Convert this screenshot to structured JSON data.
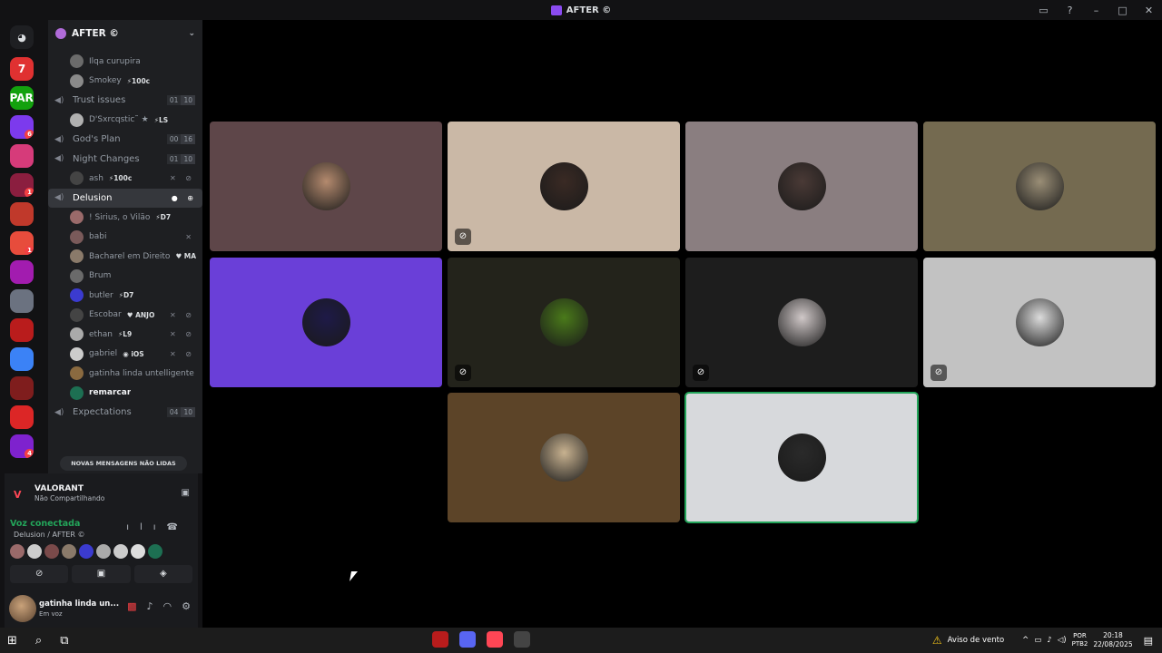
{
  "window": {
    "title": "AFTER ©"
  },
  "server": {
    "name": "AFTER ©"
  },
  "rail": [
    {
      "label": "7",
      "color": "#e03131"
    },
    {
      "label": "SPARK",
      "color": "#13a10e"
    },
    {
      "label": "",
      "color": "#7c3aed",
      "badge": "6"
    },
    {
      "label": "",
      "color": "#d63b7a"
    },
    {
      "label": "",
      "color": "#8b1e3f",
      "badge": "1"
    },
    {
      "label": "",
      "color": "#c0392b"
    },
    {
      "label": "",
      "color": "#e74c3c",
      "badge": "1"
    },
    {
      "label": "",
      "color": "#a21caf"
    },
    {
      "label": "",
      "color": "#6b7280"
    },
    {
      "label": "",
      "color": "#b91c1c"
    },
    {
      "label": "",
      "color": "#3b82f6"
    },
    {
      "label": "",
      "color": "#7f1d1d"
    },
    {
      "label": "",
      "color": "#dc2626"
    },
    {
      "label": "",
      "color": "#7e22ce",
      "badge": "4"
    }
  ],
  "channel_rows": [
    {
      "kind": "user",
      "name": "Ilqa curupira",
      "tag": "",
      "status": "",
      "avatar": "#6b6b6b"
    },
    {
      "kind": "user",
      "name": "Smokey",
      "tag": "⚡100c",
      "status": "",
      "avatar": "#8a8a8a"
    },
    {
      "kind": "channel",
      "name": "Trust issues",
      "count_a": "01",
      "count_b": "10"
    },
    {
      "kind": "user",
      "name": "D'Sxrcqstic˜ ★",
      "tag": "⚡LS",
      "status": "",
      "avatar": "#b0b0b0"
    },
    {
      "kind": "channel",
      "name": "God's Plan",
      "count_a": "00",
      "count_b": "16"
    },
    {
      "kind": "channel",
      "name": "Night Changes",
      "count_a": "01",
      "count_b": "10"
    },
    {
      "kind": "user",
      "name": "ash",
      "tag": "⚡100c",
      "status": "✕ ⊘",
      "avatar": "#444"
    },
    {
      "kind": "active",
      "name": "Delusion"
    },
    {
      "kind": "user",
      "name": "! Sirius, o Vilão",
      "tag": "⚡D7",
      "status": "",
      "avatar": "#9a6a6a"
    },
    {
      "kind": "user",
      "name": "babi",
      "tag": "",
      "status": "✕",
      "avatar": "#7a5a5a"
    },
    {
      "kind": "user",
      "name": "Bacharel em Direito",
      "tag": "♥ MA",
      "status": "",
      "avatar": "#8a7a6a"
    },
    {
      "kind": "user",
      "name": "Brum",
      "tag": "",
      "status": "",
      "avatar": "#6a6a6a"
    },
    {
      "kind": "user",
      "name": "butler",
      "tag": "⚡D7",
      "status": "",
      "avatar": "#3b3bd0"
    },
    {
      "kind": "user",
      "name": "Escobar",
      "tag": "♥ ANJO",
      "status": "✕ ⊘",
      "avatar": "#444"
    },
    {
      "kind": "user",
      "name": "ethan",
      "tag": "⚡L9",
      "status": "✕ ⊘",
      "avatar": "#aaa"
    },
    {
      "kind": "user",
      "name": "gabriel",
      "tag": "◉ iOS",
      "status": "✕ ⊘",
      "avatar": "#ccc"
    },
    {
      "kind": "user",
      "name": "gatinha linda untelligente",
      "tag": "",
      "status": "",
      "avatar": "#8a6a40"
    },
    {
      "kind": "user-bold",
      "name": "remarcar",
      "tag": "",
      "status": "",
      "avatar": "#1d6f52"
    },
    {
      "kind": "channel",
      "name": "Expectations",
      "count_a": "04",
      "count_b": "10"
    }
  ],
  "unread_pill": "NOVAS MENSAGENS NÃO LIDAS",
  "activity": {
    "title": "VALORANT",
    "subtitle": "Não Compartilhando"
  },
  "voice": {
    "status": "Voz conectada",
    "location": "Delusion / AFTER ©",
    "avatars": [
      "#9a6a6a",
      "#ccc",
      "#7a4a4a",
      "#8a7a6a",
      "#3b3bd0",
      "#aaa",
      "#ccc",
      "#ddd",
      "#1d6f52"
    ]
  },
  "user": {
    "name": "gatinha linda un...",
    "status": "Em voz"
  },
  "tiles": [
    {
      "bg": "#5e4649",
      "pfp": "#b48a6e",
      "muted": false,
      "speaking": false
    },
    {
      "bg": "#cab8a6",
      "pfp": "#3a2a24",
      "muted": true,
      "speaking": false
    },
    {
      "bg": "#8a7e80",
      "pfp": "#4a3a36",
      "muted": false,
      "speaking": false
    },
    {
      "bg": "#746a50",
      "pfp": "#9a8e76",
      "muted": false,
      "speaking": false
    },
    {
      "bg": "#6a3fd8",
      "pfp": "#1e1a48",
      "muted": false,
      "speaking": false
    },
    {
      "bg": "#23231b",
      "pfp": "#4a7a1a",
      "muted": true,
      "speaking": false
    },
    {
      "bg": "#1d1d1d",
      "pfp": "#d0c8c8",
      "muted": true,
      "speaking": false
    },
    {
      "bg": "#c2c2c2",
      "pfp": "#dcdcdc",
      "muted": true,
      "speaking": false
    },
    {
      "bg": "#5c4428",
      "pfp": "#c8b290",
      "muted": false,
      "speaking": false
    },
    {
      "bg": "#d7d9dc",
      "pfp": "#2a2a2a",
      "muted": false,
      "speaking": true
    }
  ],
  "taskbar": {
    "warning": "Aviso de vento",
    "lang_top": "POR",
    "lang_bottom": "PTB2",
    "time": "20:18",
    "date": "22/08/2025"
  }
}
